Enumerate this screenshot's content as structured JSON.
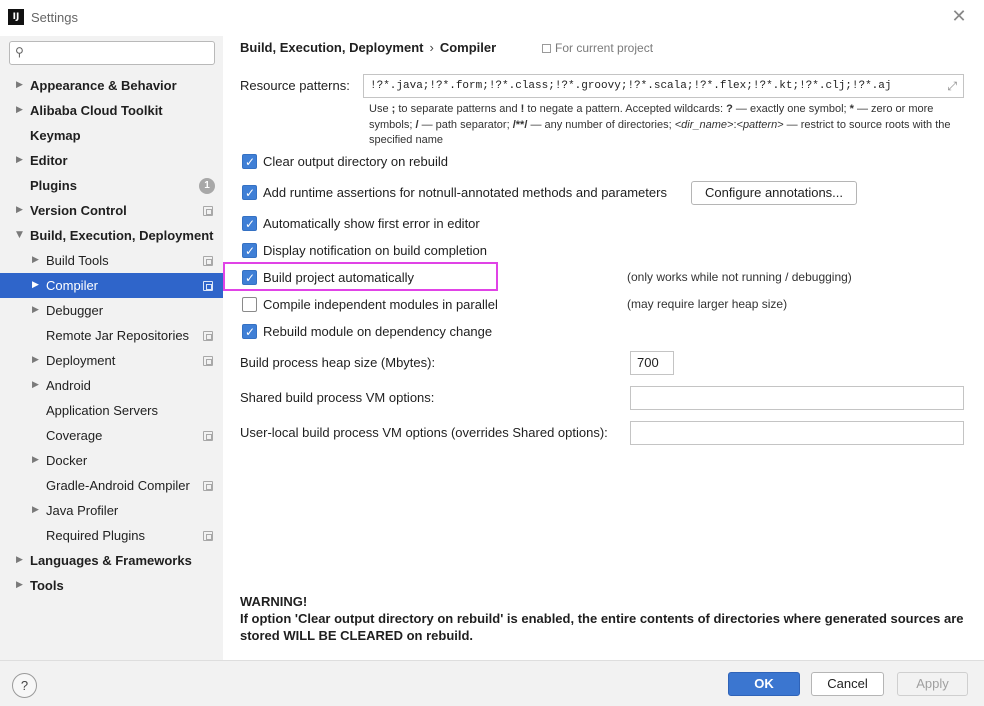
{
  "window": {
    "title": "Settings",
    "app_icon_text": "IJ",
    "close_glyph": "✕"
  },
  "search": {
    "placeholder": "",
    "value": "",
    "icon": "search-icon"
  },
  "sidebar": {
    "items": [
      {
        "label": "Appearance & Behavior",
        "bold": true,
        "arrow": "▶",
        "indent": 0
      },
      {
        "label": "Alibaba Cloud Toolkit",
        "bold": true,
        "arrow": "▶",
        "indent": 0
      },
      {
        "label": "Keymap",
        "bold": true,
        "arrow": "",
        "indent": 0
      },
      {
        "label": "Editor",
        "bold": true,
        "arrow": "▶",
        "indent": 0
      },
      {
        "label": "Plugins",
        "bold": true,
        "arrow": "",
        "indent": 0,
        "badge": "1"
      },
      {
        "label": "Version Control",
        "bold": true,
        "arrow": "▶",
        "indent": 0,
        "copy": true
      },
      {
        "label": "Build, Execution, Deployment",
        "bold": true,
        "arrow": "▼",
        "indent": 0
      },
      {
        "label": "Build Tools",
        "bold": false,
        "arrow": "▶",
        "indent": 1,
        "copy": true
      },
      {
        "label": "Compiler",
        "bold": false,
        "arrow": "▶",
        "indent": 1,
        "copy": true,
        "selected": true
      },
      {
        "label": "Debugger",
        "bold": false,
        "arrow": "▶",
        "indent": 1
      },
      {
        "label": "Remote Jar Repositories",
        "bold": false,
        "arrow": "",
        "indent": 1,
        "copy": true
      },
      {
        "label": "Deployment",
        "bold": false,
        "arrow": "▶",
        "indent": 1,
        "copy": true
      },
      {
        "label": "Android",
        "bold": false,
        "arrow": "▶",
        "indent": 1
      },
      {
        "label": "Application Servers",
        "bold": false,
        "arrow": "",
        "indent": 1
      },
      {
        "label": "Coverage",
        "bold": false,
        "arrow": "",
        "indent": 1,
        "copy": true
      },
      {
        "label": "Docker",
        "bold": false,
        "arrow": "▶",
        "indent": 1
      },
      {
        "label": "Gradle-Android Compiler",
        "bold": false,
        "arrow": "",
        "indent": 1,
        "copy": true
      },
      {
        "label": "Java Profiler",
        "bold": false,
        "arrow": "▶",
        "indent": 1
      },
      {
        "label": "Required Plugins",
        "bold": false,
        "arrow": "",
        "indent": 1,
        "copy": true
      },
      {
        "label": "Languages & Frameworks",
        "bold": true,
        "arrow": "▶",
        "indent": 0
      },
      {
        "label": "Tools",
        "bold": true,
        "arrow": "▶",
        "indent": 0
      }
    ]
  },
  "breadcrumb": {
    "parent": "Build, Execution, Deployment",
    "separator": "›",
    "current": "Compiler"
  },
  "scope_label": "For current project",
  "resource_patterns": {
    "label": "Resource patterns:",
    "value": "!?*.java;!?*.form;!?*.class;!?*.groovy;!?*.scala;!?*.flex;!?*.kt;!?*.clj;!?*.aj",
    "expand_glyph": "⤢"
  },
  "hint": {
    "p1": "Use ",
    "p2": ";",
    "p3": " to separate patterns and ",
    "p4": "!",
    "p5": " to negate a pattern. Accepted wildcards: ",
    "p6": "?",
    "p7": " — exactly one symbol; ",
    "p8": "*",
    "p9": " — zero or more symbols; ",
    "p10": "/",
    "p11": " — path separator; ",
    "p12": "/**/",
    "p13": " — any number of directories; ",
    "p14": "<dir_name>",
    "p15": ":",
    "p16": "<pattern>",
    "p17": " — restrict to source roots with the specified name"
  },
  "options": [
    {
      "label": "Clear output directory on rebuild",
      "checked": true,
      "note": ""
    },
    {
      "label": "Add runtime assertions for notnull-annotated methods and parameters",
      "checked": true,
      "note": ""
    },
    {
      "label": "Automatically show first error in editor",
      "checked": true,
      "note": ""
    },
    {
      "label": "Display notification on build completion",
      "checked": true,
      "note": ""
    },
    {
      "label": "Build project automatically",
      "checked": true,
      "note": "(only works while not running / debugging)"
    },
    {
      "label": "Compile independent modules in parallel",
      "checked": false,
      "note": "(may require larger heap size)"
    },
    {
      "label": "Rebuild module on dependency change",
      "checked": true,
      "note": ""
    }
  ],
  "configure_annotations_label": "Configure annotations...",
  "heap": {
    "label": "Build process heap size (Mbytes):",
    "value": "700"
  },
  "shared_vm": {
    "label": "Shared build process VM options:",
    "value": ""
  },
  "user_vm": {
    "label": "User-local build process VM options (overrides Shared options):",
    "value": ""
  },
  "warning": {
    "title": "WARNING!",
    "body": "If option 'Clear output directory on rebuild' is enabled, the entire contents of directories where generated sources are stored WILL BE CLEARED on rebuild."
  },
  "footer": {
    "help": "?",
    "ok": "OK",
    "cancel": "Cancel",
    "apply": "Apply"
  },
  "colors": {
    "selection": "#2f65ca",
    "highlight_box": "#e043e6",
    "checkbox": "#3f7fd6",
    "ok_button": "#3b76d0"
  }
}
